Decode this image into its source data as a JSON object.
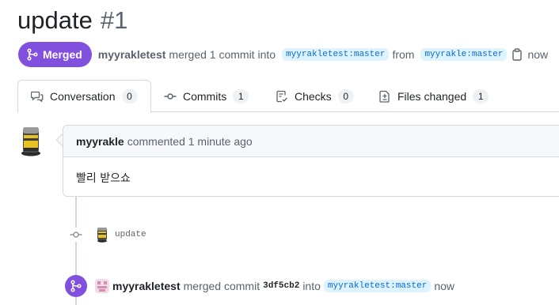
{
  "pr": {
    "title": "update",
    "number": "#1",
    "state_label": "Merged",
    "author": "myyrakletest",
    "summary": "merged 1 commit into",
    "base_branch": "myyrakletest:master",
    "from_word": "from",
    "head_branch": "myyrakle:master",
    "time": "now"
  },
  "tabs": [
    {
      "label": "Conversation",
      "count": "0",
      "icon": "comment-discussion-icon"
    },
    {
      "label": "Commits",
      "count": "1",
      "icon": "git-commit-icon"
    },
    {
      "label": "Checks",
      "count": "0",
      "icon": "checklist-icon"
    },
    {
      "label": "Files changed",
      "count": "1",
      "icon": "file-diff-icon"
    }
  ],
  "comment": {
    "author": "myyrakle",
    "meta": "commented 1 minute ago",
    "body": "빨리 받으쇼"
  },
  "commit": {
    "message": "update"
  },
  "merge_event": {
    "user": "myyrakletest",
    "text": "merged commit",
    "sha": "3df5cb2",
    "into_word": "into",
    "branch": "myyrakletest:master",
    "time": "now"
  },
  "colors": {
    "merged_purple": "#8250df",
    "link_blue": "#0969da",
    "branch_bg": "#ddf4ff",
    "muted": "#59636e"
  }
}
